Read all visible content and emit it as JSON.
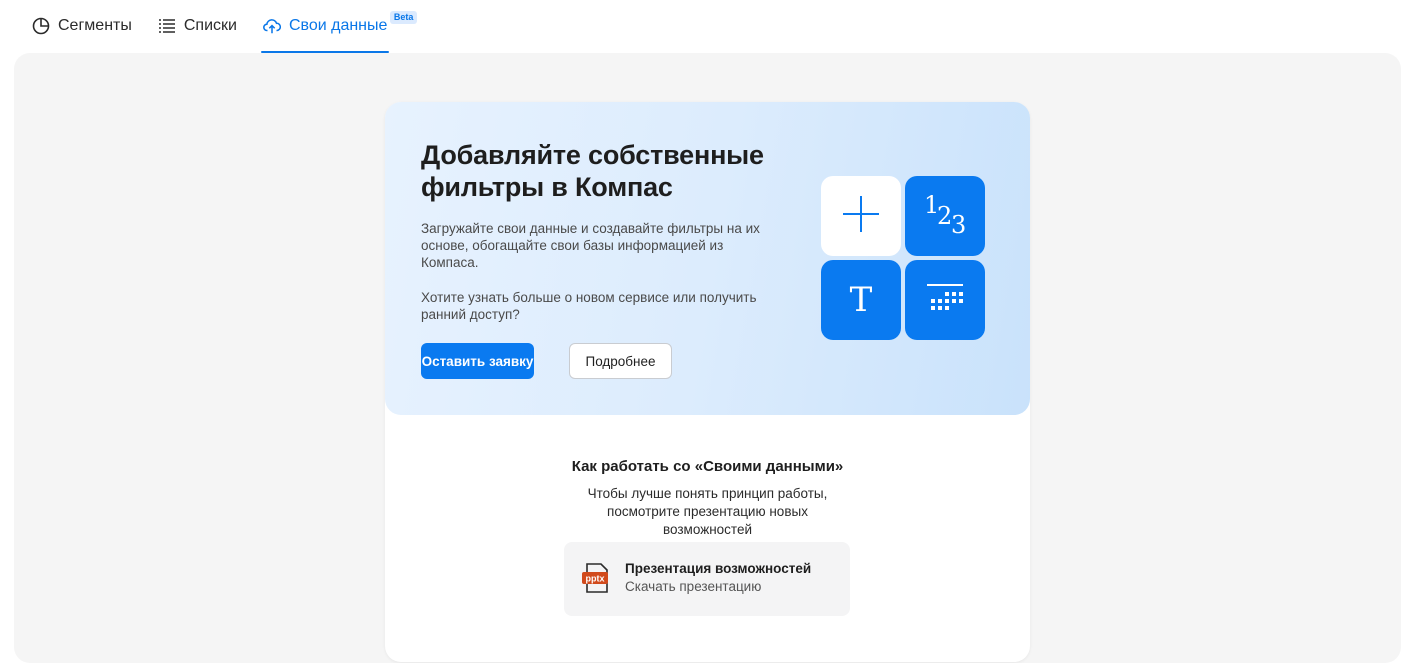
{
  "tabs": [
    {
      "label": "Сегменты",
      "icon": "pie-chart-icon",
      "active": false
    },
    {
      "label": "Списки",
      "icon": "list-icon",
      "active": false
    },
    {
      "label": "Свои данные",
      "icon": "cloud-upload-icon",
      "active": true,
      "badge": "Beta"
    }
  ],
  "hero": {
    "title": "Добавляйте собственные фильтры в Компас",
    "paragraph1": "Загружайте свои данные и создавайте фильтры на их основе, обогащайте свои базы информацией из Компаса.",
    "paragraph2": "Хотите узнать больше о новом сервисе или получить ранний доступ?",
    "primary_button": "Оставить заявку",
    "secondary_button": "Подробнее",
    "tiles": [
      {
        "icon": "plus-icon"
      },
      {
        "icon": "numbers-icon",
        "text": "1",
        "text2": "2",
        "text3": "3"
      },
      {
        "icon": "text-icon",
        "text": "T"
      },
      {
        "icon": "calendar-icon"
      }
    ]
  },
  "how": {
    "title": "Как работать со «Своими данными»",
    "subtitle": "Чтобы лучше понять принцип работы, посмотрите презентацию новых возможностей"
  },
  "file": {
    "title": "Презентация возможностей",
    "subtitle": "Скачать презентацию",
    "badge": "pptx"
  },
  "colors": {
    "accent": "#0a7af0",
    "hero_bg": "#dcecfd",
    "panel_bg": "#f5f5f5"
  }
}
